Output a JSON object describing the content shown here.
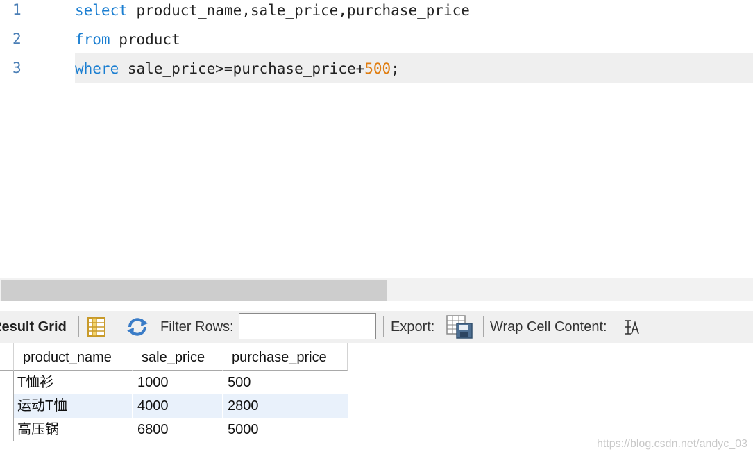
{
  "editor": {
    "lines": [
      {
        "num": "1",
        "kw": "select",
        "rest": " product_name,sale_price,purchase_price"
      },
      {
        "num": "2",
        "kw": "from",
        "rest": " product"
      },
      {
        "num": "3",
        "kw": "where",
        "rest": " sale_price>=purchase_price+",
        "number": "500",
        "tail": ";"
      }
    ]
  },
  "toolbar": {
    "result_grid_label": "Result Grid",
    "filter_label": "Filter Rows:",
    "filter_value": "",
    "export_label": "Export:",
    "wrap_label": "Wrap Cell Content:"
  },
  "grid": {
    "columns": [
      "product_name",
      "sale_price",
      "purchase_price"
    ],
    "rows": [
      [
        "T恤衫",
        "1000",
        "500"
      ],
      [
        "运动T恤",
        "4000",
        "2800"
      ],
      [
        "高压锅",
        "6800",
        "5000"
      ]
    ]
  },
  "watermark": "https://blog.csdn.net/andyc_03",
  "colors": {
    "keyword": "#1a7ed1",
    "number": "#e07d10",
    "line_number": "#4b7fb6",
    "selected_row": "#e9f1fb"
  }
}
